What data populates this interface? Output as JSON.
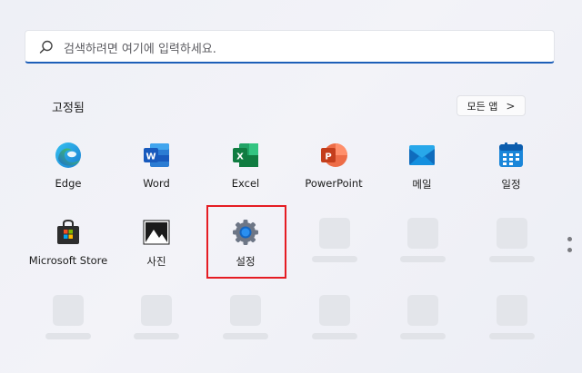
{
  "search": {
    "placeholder": "검색하려면 여기에 입력하세요.",
    "icon": "search-icon"
  },
  "pinned": {
    "title": "고정됨",
    "all_apps_label": "모든 앱",
    "all_apps_chevron": ">"
  },
  "apps": [
    {
      "label": "Edge",
      "icon": "edge-icon"
    },
    {
      "label": "Word",
      "icon": "word-icon"
    },
    {
      "label": "Excel",
      "icon": "excel-icon"
    },
    {
      "label": "PowerPoint",
      "icon": "powerpoint-icon"
    },
    {
      "label": "메일",
      "icon": "mail-icon"
    },
    {
      "label": "일정",
      "icon": "calendar-icon"
    },
    {
      "label": "Microsoft Store",
      "icon": "store-icon"
    },
    {
      "label": "사진",
      "icon": "photos-icon"
    },
    {
      "label": "설정",
      "icon": "settings-icon"
    }
  ],
  "colors": {
    "search_accent": "#1d5fb8",
    "highlight": "#e51c23"
  }
}
